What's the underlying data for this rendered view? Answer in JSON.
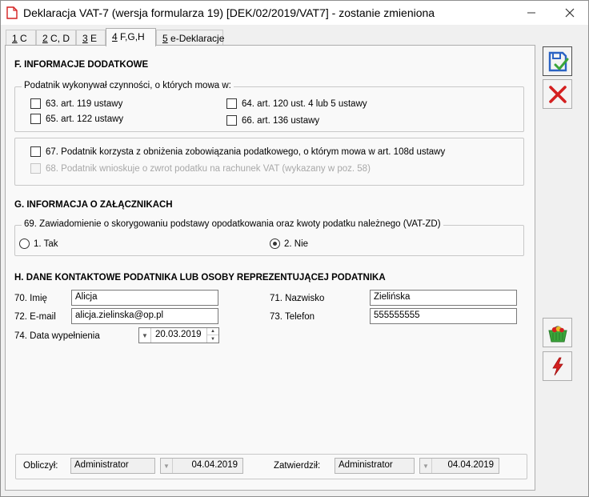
{
  "window": {
    "title": "Deklaracja VAT-7 (wersja formularza 19) [DEK/02/2019/VAT7] - zostanie zmieniona"
  },
  "tabs": [
    {
      "key": "1",
      "label": " C"
    },
    {
      "key": "2",
      "label": " C, D"
    },
    {
      "key": "3",
      "label": " E"
    },
    {
      "key": "4",
      "label": " F,G,H"
    },
    {
      "key": "5",
      "label": " e-Deklaracje"
    }
  ],
  "active_tab": 3,
  "section_f": {
    "title": "F. INFORMACJE DODATKOWE",
    "group_legend": "Podatnik wykonywał czynności, o których mowa w:",
    "cb63": "63. art. 119 ustawy",
    "cb64": "64. art. 120 ust. 4 lub 5 ustawy",
    "cb65": "65. art. 122 ustawy",
    "cb66": "66. art. 136 ustawy",
    "cb67": "67. Podatnik korzysta z obniżenia zobowiązania podatkowego, o którym mowa w art. 108d ustawy",
    "cb68": "68. Podatnik wnioskuje o zwrot podatku na rachunek VAT (wykazany w poz. 58)"
  },
  "section_g": {
    "title": "G. INFORMACJA O ZAŁĄCZNIKACH",
    "group_legend": "69. Zawiadomienie o skorygowaniu podstawy opodatkowania oraz kwoty podatku należnego (VAT-ZD)",
    "radio_yes": "1. Tak",
    "radio_no": "2. Nie",
    "selected": "2. Nie"
  },
  "section_h": {
    "title": "H. DANE KONTAKTOWE PODATNIKA LUB OSOBY REPREZENTUJĄCEJ PODATNIKA",
    "imie_label": "70. Imię",
    "imie_value": "Alicja",
    "nazwisko_label": "71. Nazwisko",
    "nazwisko_value": "Zielińska",
    "email_label": "72. E-mail",
    "email_value": "alicja.zielinska@op.pl",
    "telefon_label": "73. Telefon",
    "telefon_value": "555555555",
    "data_label": "74. Data wypełnienia",
    "data_value": "20.03.2019"
  },
  "footer": {
    "obliczyl_label": "Obliczył:",
    "obliczyl_user": "Administrator",
    "obliczyl_date": "04.04.2019",
    "zatwierdzil_label": "Zatwierdził:",
    "zatwierdzil_user": "Administrator",
    "zatwierdzil_date": "04.04.2019"
  },
  "colors": {
    "save_icon": "#2b63c4",
    "check": "#3aa53a",
    "cancel_x": "#d42020",
    "flash": "#d42020"
  }
}
